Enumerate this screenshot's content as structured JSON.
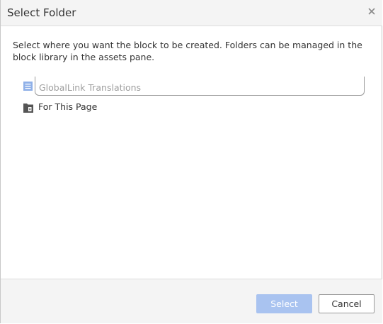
{
  "dialog": {
    "title": "Select Folder",
    "close_icon": "close-icon",
    "description": "Select where you want the block to be created. Folders can be managed in the block library in the assets pane."
  },
  "tree": {
    "items": [
      {
        "icon": "list-icon",
        "value": "GlobalLink Translations",
        "editing": true
      },
      {
        "icon": "page-folder-icon",
        "label": "For This Page"
      }
    ]
  },
  "footer": {
    "select_label": "Select",
    "cancel_label": "Cancel"
  },
  "colors": {
    "accent_disabled": "#a9c3f0",
    "title_bar": "#f4f4f4"
  }
}
